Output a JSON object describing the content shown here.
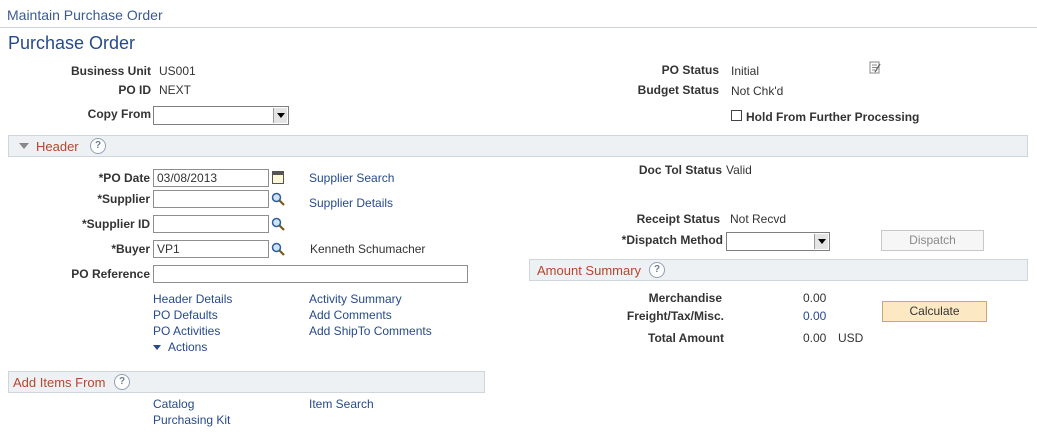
{
  "breadcrumb": "Maintain Purchase Order",
  "page_title": "Purchase Order",
  "info": {
    "business_unit_label": "Business Unit",
    "business_unit_value": "US001",
    "po_id_label": "PO ID",
    "po_id_value": "NEXT",
    "copy_from_label": "Copy From",
    "copy_from_value": "",
    "po_status_label": "PO Status",
    "po_status_value": "Initial",
    "budget_status_label": "Budget Status",
    "budget_status_value": "Not Chk'd",
    "hold_label": "Hold From Further Processing"
  },
  "header_section": {
    "title": "Header",
    "help": "?",
    "po_date_label": "*PO Date",
    "po_date_value": "03/08/2013",
    "supplier_label": "*Supplier",
    "supplier_value": "",
    "supplier_id_label": "*Supplier ID",
    "supplier_id_value": "",
    "buyer_label": "*Buyer",
    "buyer_value": "VP1",
    "buyer_name": "Kenneth Schumacher",
    "po_reference_label": "PO Reference",
    "po_reference_value": "",
    "supplier_search_link": "Supplier Search",
    "supplier_details_link": "Supplier Details",
    "doc_tol_status_label": "Doc Tol Status",
    "doc_tol_status_value": "Valid",
    "receipt_status_label": "Receipt Status",
    "receipt_status_value": "Not Recvd",
    "dispatch_method_label": "*Dispatch Method",
    "dispatch_method_value": "",
    "dispatch_button": "Dispatch",
    "links": {
      "header_details": "Header Details",
      "po_defaults": "PO Defaults",
      "po_activities": "PO Activities",
      "actions": "Actions",
      "activity_summary": "Activity Summary",
      "add_comments": "Add Comments",
      "add_shipto_comments": "Add ShipTo Comments"
    }
  },
  "amount_summary": {
    "title": "Amount Summary",
    "help": "?",
    "merchandise_label": "Merchandise",
    "merchandise_value": "0.00",
    "freight_label": "Freight/Tax/Misc.",
    "freight_value": "0.00",
    "total_label": "Total Amount",
    "total_value": "0.00",
    "currency": "USD",
    "calculate_button": "Calculate"
  },
  "add_items": {
    "title": "Add Items From",
    "help": "?",
    "catalog": "Catalog",
    "purchasing_kit": "Purchasing Kit",
    "item_search": "Item Search"
  }
}
